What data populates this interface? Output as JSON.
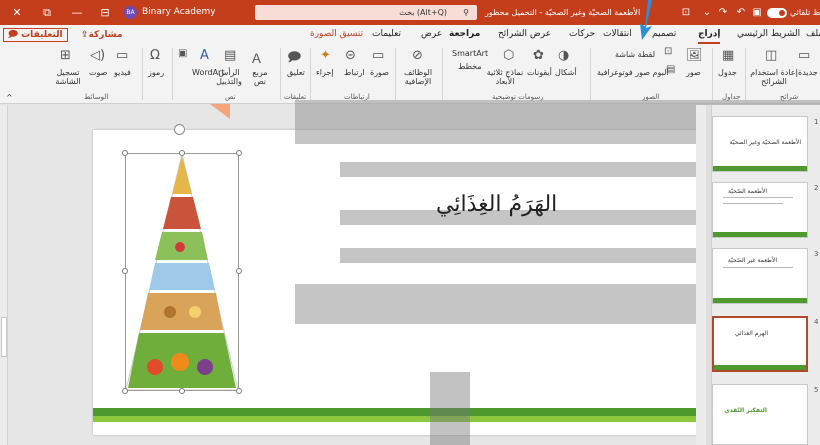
{
  "titlebar": {
    "username": "Binary Academy",
    "user_initials": "BA",
    "search_text": "بحث (Alt+Q)",
    "doc_title": "الأطعمة الصحيّة وغير الصحيّة - التحميل محظور",
    "autosave_label": "حفظ تلقائي",
    "autosave_state": "On",
    "close_icon": "✕",
    "restore_icon": "⧉",
    "minimize_icon": "—",
    "ribbon_display_icon": "⊟"
  },
  "tabs": {
    "file": "ملف",
    "home": "الشريط الرئيسي",
    "insert": "إدراج",
    "design": "تصميم",
    "transitions": "انتقالات",
    "animations": "حركات",
    "slideshow": "عرض الشرائح",
    "review": "مراجعة",
    "view": "عرض",
    "help": "تعليمات",
    "shape_format": "تنسيق الصورة",
    "share": "مشاركة",
    "comments": "التعليقات"
  },
  "ribbon": {
    "slides_group": {
      "new_slide": "شريحة جديدة",
      "reuse": "إعادة استخدام الشرائح",
      "label": "شرائح"
    },
    "tables_group": {
      "table": "جدول",
      "label": "جداول"
    },
    "images_group": {
      "pictures": "صور",
      "screenshot": "لقطة شاشة",
      "photo_album": "ألبوم صور فوتوغرافية",
      "label": "الصور"
    },
    "illustrations_group": {
      "shapes": "أشكال",
      "icons": "أيقونات",
      "3d_models": "نماذج ثلاثية الأبعاد",
      "smartart": "SmartArt",
      "chart": "مخطط",
      "label": "رسومات توضيحية"
    },
    "addins_group": {
      "addins": "الوظائف الإضافية",
      "label": ""
    },
    "links_group": {
      "zoom": "صورة",
      "link": "ارتباط",
      "action": "إجراء",
      "label": "ارتباطات"
    },
    "comments_group": {
      "comment": "تعليق",
      "label": "تعليقات"
    },
    "text_group": {
      "textbox": "مربع نص",
      "header_footer": "الرأس والتذييل",
      "wordart": "WordArt",
      "label": "نص"
    },
    "symbols_group": {
      "symbols": "رموز"
    },
    "media_group": {
      "video": "فيديو",
      "audio": "صوت",
      "screen_recording": "تسجيل الشاشة",
      "label": "الوسائط"
    }
  },
  "slide": {
    "title": "الهَرَمُ الغِذَائِي"
  },
  "thumbnails": {
    "t1": "الأطعمة الصحيّة وغير الصحيّة",
    "t2": "الأطعمة الصّحيّة",
    "t3": "الأطعمة غير الصّحيّة",
    "t4": "الهرم الغذائي",
    "t5": "التفكير النّقدي",
    "n1": "1",
    "n2": "2",
    "n3": "3",
    "n4": "4",
    "n5": "5"
  },
  "colors": {
    "titlebar": "#c43e1c",
    "accent_green": "#4e9a2e",
    "selection_border": "#b04a2a"
  }
}
